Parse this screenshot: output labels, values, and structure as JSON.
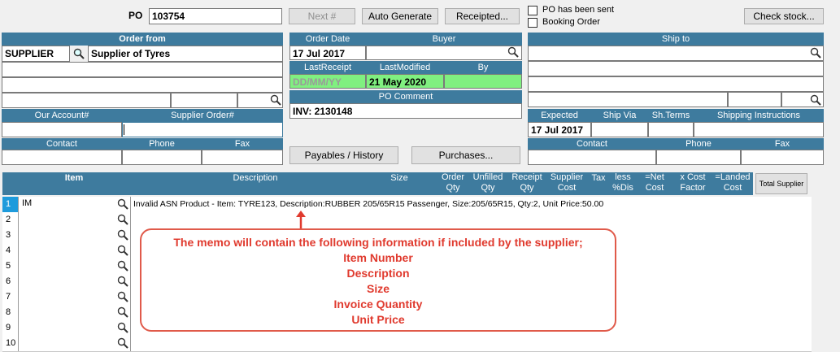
{
  "po": {
    "label": "PO",
    "value": "103754"
  },
  "buttons": {
    "next": "Next #",
    "auto_generate": "Auto Generate",
    "receipted": "Receipted...",
    "check_stock": "Check stock...",
    "payables_history": "Payables / History",
    "purchases": "Purchases...",
    "total_supplier": "Total Supplier"
  },
  "checks": {
    "sent": "PO has been sent",
    "booking": "Booking Order"
  },
  "order_from": {
    "header": "Order from",
    "code": "SUPPLIER",
    "name": "Supplier of Tyres",
    "our_account_label": "Our Account#",
    "supplier_order_label": "Supplier Order#",
    "contact_label": "Contact",
    "phone_label": "Phone",
    "fax_label": "Fax"
  },
  "middle": {
    "order_date_label": "Order Date",
    "order_date": "17 Jul 2017",
    "buyer_label": "Buyer",
    "last_receipt_label": "LastReceipt",
    "last_receipt": "DD/MM/YY",
    "last_modified_label": "LastModified",
    "last_modified": "21 May 2020",
    "by_label": "By",
    "po_comment_label": "PO Comment",
    "po_comment": "INV: 2130148"
  },
  "ship_to": {
    "header": "Ship to",
    "expected_label": "Expected",
    "expected": "17 Jul 2017",
    "ship_via_label": "Ship Via",
    "sh_terms_label": "Sh.Terms",
    "shipping_instructions_label": "Shipping Instructions",
    "contact_label": "Contact",
    "phone_label": "Phone",
    "fax_label": "Fax"
  },
  "grid": {
    "columns": {
      "item": "Item",
      "description": "Description",
      "size": "Size",
      "order_qty": "Order\nQty",
      "unfilled_qty": "Unfilled\nQty",
      "receipt_qty": "Receipt\nQty",
      "supplier_cost": "Supplier\nCost",
      "tax": "Tax",
      "less_dis": "less\n%Dis",
      "net_cost": "=Net\nCost",
      "cost_factor": "x Cost\nFactor",
      "landed_cost": "=Landed\nCost"
    },
    "rows": [
      {
        "num": "1",
        "item": "IM",
        "desc": "Invalid ASN Product - Item: TYRE123, Description:RUBBER 205/65R15 Passenger, Size:205/65R15, Qty:2, Unit Price:50.00"
      },
      {
        "num": "2",
        "item": "",
        "desc": ""
      },
      {
        "num": "3",
        "item": "",
        "desc": ""
      },
      {
        "num": "4",
        "item": "",
        "desc": ""
      },
      {
        "num": "5",
        "item": "",
        "desc": ""
      },
      {
        "num": "6",
        "item": "",
        "desc": ""
      },
      {
        "num": "7",
        "item": "",
        "desc": ""
      },
      {
        "num": "8",
        "item": "",
        "desc": ""
      },
      {
        "num": "9",
        "item": "",
        "desc": ""
      },
      {
        "num": "10",
        "item": "",
        "desc": ""
      }
    ]
  },
  "annotation": {
    "lines": [
      "The memo will contain the following information if included by the supplier;",
      "Item Number",
      "Description",
      "Size",
      "Invoice Quantity",
      "Unit Price"
    ],
    "color": "#e03a2e"
  },
  "icons": {
    "search": "magnifier-icon",
    "arrow": "arrow-up-icon"
  },
  "colors": {
    "header": "#3e7b9e",
    "highlight": "#80f080",
    "selected_row": "#1e9bdc"
  }
}
